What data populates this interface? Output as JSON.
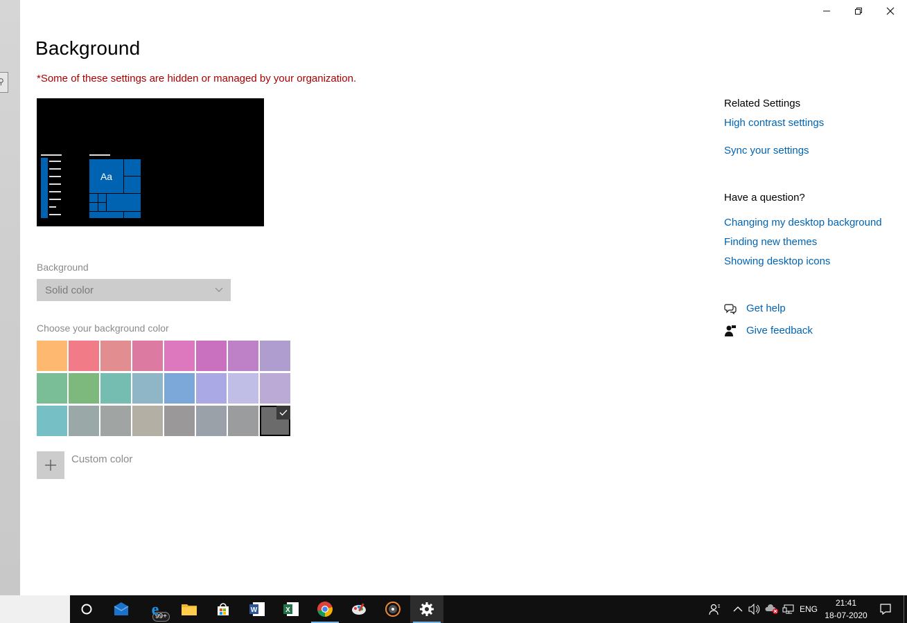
{
  "window": {
    "minimize_icon": "minimize-icon",
    "maximize_icon": "restore-icon",
    "close_icon": "close-icon"
  },
  "page": {
    "title": "Background",
    "org_notice": "*Some of these settings are hidden or managed by your organization."
  },
  "preview": {
    "sample_text": "Aa"
  },
  "background": {
    "label": "Background",
    "selected": "Solid color"
  },
  "colors": {
    "label": "Choose your background color",
    "selected_index": 23,
    "swatches": [
      "#FFB86F",
      "#F17B86",
      "#E28D8F",
      "#DD7AA1",
      "#DD77BE",
      "#C971BF",
      "#BE80C7",
      "#AE9DCE",
      "#79BE96",
      "#7DB87D",
      "#75BDB1",
      "#8EB6C6",
      "#7BA8D8",
      "#AAA9E6",
      "#C0BDE6",
      "#BBA9D6",
      "#76BFC4",
      "#9AA9A7",
      "#A0A5A3",
      "#B4AFA4",
      "#9A9899",
      "#9AA1A9",
      "#9B9C9E",
      "#6B6B6B"
    ],
    "custom_label": "Custom color"
  },
  "related": {
    "heading": "Related Settings",
    "links": [
      "High contrast settings",
      "Sync your settings"
    ]
  },
  "question": {
    "heading": "Have a question?",
    "links": [
      "Changing my desktop background",
      "Finding new themes",
      "Showing desktop icons"
    ]
  },
  "help": {
    "get_help": "Get help",
    "give_feedback": "Give feedback"
  },
  "taskbar": {
    "mail_badge": "99+",
    "language": "ENG",
    "time": "21:41",
    "date": "18-07-2020"
  }
}
